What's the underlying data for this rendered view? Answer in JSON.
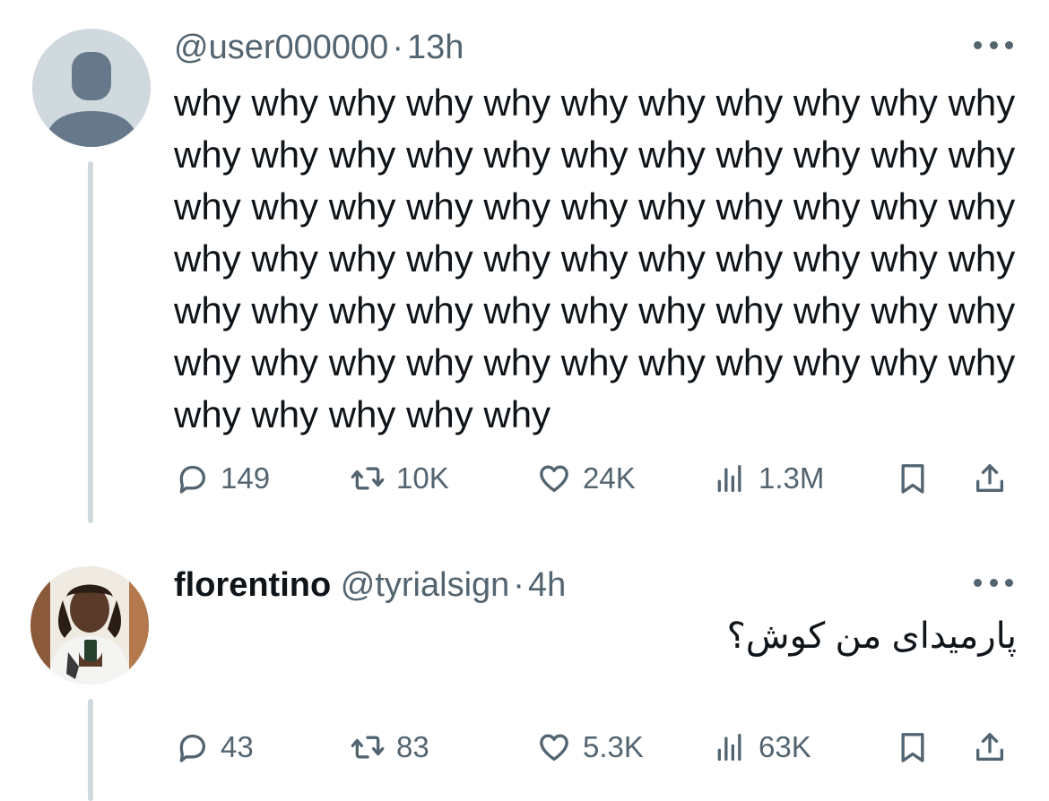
{
  "tweets": [
    {
      "display_name": "",
      "handle": "@user000000",
      "separator": "·",
      "time": "13h",
      "text": "why why why why why why why why why why why why why why why why why why why why why why why why why why why why why why why why why why why why why why why why why why why why why why why why why why why why why why why why why why why why why why why why why why why why why why why",
      "direction": "ltr",
      "avatar": "default-avatar",
      "stats": {
        "replies": "149",
        "retweets": "10K",
        "likes": "24K",
        "views": "1.3M"
      }
    },
    {
      "display_name": "florentino",
      "handle": "@tyrialsign",
      "separator": "·",
      "time": "4h",
      "text": "پارمیدای من کوش؟",
      "direction": "rtl",
      "avatar": "photo-avatar",
      "stats": {
        "replies": "43",
        "retweets": "83",
        "likes": "5.3K",
        "views": "63K"
      }
    }
  ],
  "icons": [
    "more-icon",
    "reply-icon",
    "retweet-icon",
    "like-icon",
    "views-icon",
    "bookmark-icon",
    "share-icon"
  ],
  "colors": {
    "text": "#0f1419",
    "secondary": "#536471",
    "thread_line": "#cfd9de",
    "avatar_bg": "#cfd9de"
  }
}
